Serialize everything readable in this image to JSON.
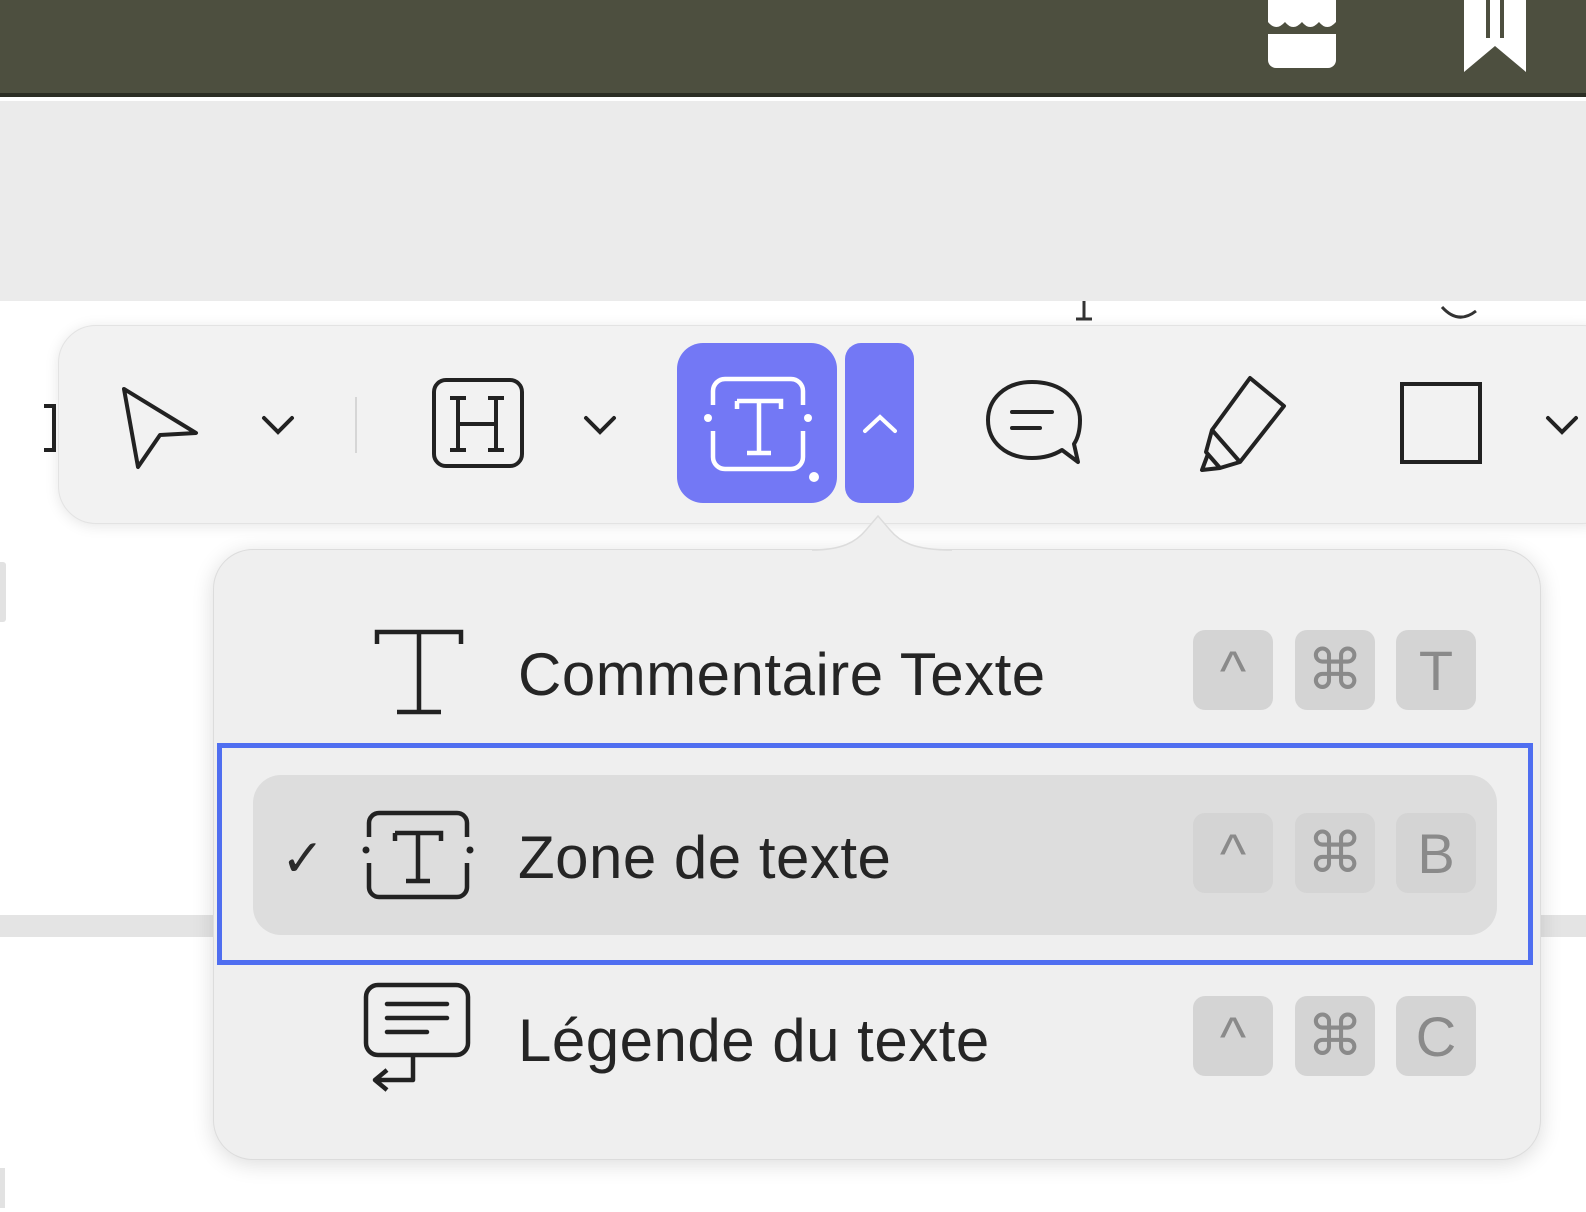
{
  "menu": {
    "items": [
      {
        "label": "Commentaire Texte",
        "checked": false,
        "icon": "text-t-icon",
        "shortcut": [
          "^",
          "⌘",
          "T"
        ]
      },
      {
        "label": "Zone de texte",
        "checked": true,
        "icon": "text-box-icon",
        "shortcut": [
          "^",
          "⌘",
          "B"
        ]
      },
      {
        "label": "Légende du texte",
        "checked": false,
        "icon": "text-callout-icon",
        "shortcut": [
          "^",
          "⌘",
          "C"
        ]
      }
    ],
    "check_mark": "✓"
  },
  "toolbar": {
    "tools": [
      "select-arrow-icon",
      "heading-h-icon",
      "text-box-icon",
      "comment-bubble-icon",
      "highlighter-pen-icon",
      "rectangle-shape-icon"
    ],
    "active_tool": "text-box-icon",
    "accent": "#7378f5"
  },
  "colors": {
    "topbar": "#4d4f3f",
    "selection_outline": "#4f6ef0"
  }
}
